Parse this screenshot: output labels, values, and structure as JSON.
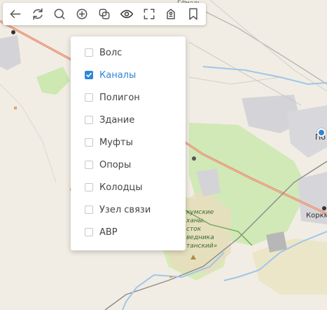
{
  "toolbar": {
    "buttons": [
      {
        "icon": "arrow-left-icon"
      },
      {
        "icon": "refresh-icon"
      },
      {
        "icon": "search-icon"
      },
      {
        "icon": "zoom-in-icon"
      },
      {
        "icon": "layers-icon"
      },
      {
        "icon": "eye-icon"
      },
      {
        "icon": "fullscreen-icon"
      },
      {
        "icon": "marker-icon"
      },
      {
        "icon": "bookmark-icon"
      }
    ]
  },
  "layers_menu": {
    "items": [
      {
        "label": "Волс",
        "checked": false
      },
      {
        "label": "Каналы",
        "checked": true
      },
      {
        "label": "Полигон",
        "checked": false
      },
      {
        "label": "Здание",
        "checked": false
      },
      {
        "label": "Муфты",
        "checked": false
      },
      {
        "label": "Опоры",
        "checked": false
      },
      {
        "label": "Колодцы",
        "checked": false
      },
      {
        "label": "Узел связи",
        "checked": false
      },
      {
        "label": "АВР",
        "checked": false
      }
    ]
  },
  "map": {
    "labels": {
      "top_fragment": "Гомель",
      "town_right": "По",
      "town_bottom_right": "Коркм",
      "reserve_line1": "кумские",
      "reserve_line2": "ханы.",
      "reserve_line3": "сток",
      "reserve_line4": "ведника",
      "reserve_line5": "танский»"
    }
  },
  "colors": {
    "accent": "#2f86d6",
    "map_background": "#f1ede4",
    "forest": "#cde8b0",
    "road_main": "#e0876b",
    "river": "#9fc6e8",
    "urban": "#d4d4d8"
  }
}
